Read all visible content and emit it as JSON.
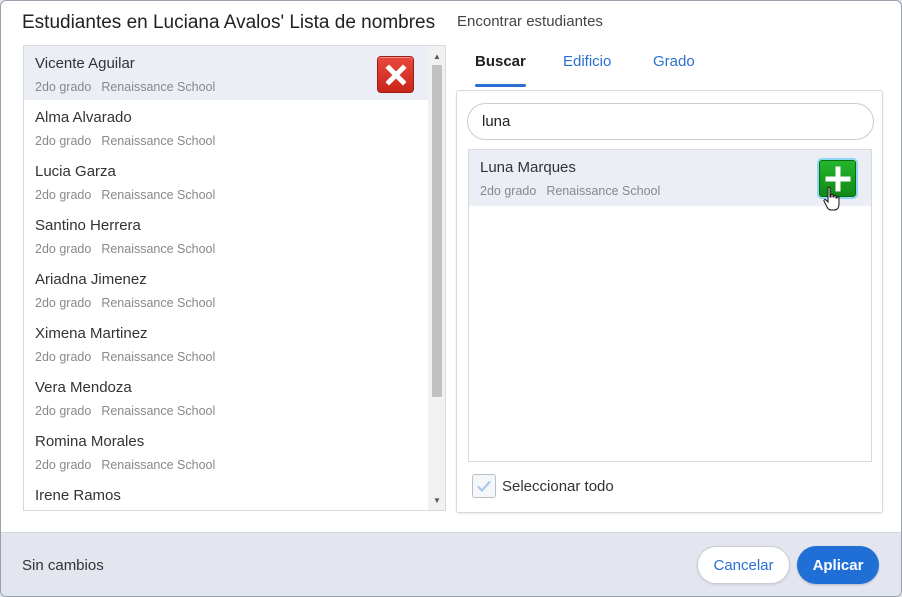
{
  "dialog": {
    "title": "Estudiantes en Luciana Avalos' Lista de nombres",
    "find_title": "Encontrar estudiantes"
  },
  "roster": {
    "students": [
      {
        "name": "Vicente Aguilar",
        "grade": "2do grado",
        "school": "Renaissance School"
      },
      {
        "name": "Alma Alvarado",
        "grade": "2do grado",
        "school": "Renaissance School"
      },
      {
        "name": "Lucia Garza",
        "grade": "2do grado",
        "school": "Renaissance School"
      },
      {
        "name": "Santino Herrera",
        "grade": "2do grado",
        "school": "Renaissance School"
      },
      {
        "name": "Ariadna Jimenez",
        "grade": "2do grado",
        "school": "Renaissance School"
      },
      {
        "name": "Ximena Martinez",
        "grade": "2do grado",
        "school": "Renaissance School"
      },
      {
        "name": "Vera Mendoza",
        "grade": "2do grado",
        "school": "Renaissance School"
      },
      {
        "name": "Romina Morales",
        "grade": "2do grado",
        "school": "Renaissance School"
      },
      {
        "name": "Irene Ramos",
        "grade": "",
        "school": ""
      }
    ]
  },
  "tabs": {
    "search": "Buscar",
    "building": "Edificio",
    "grade": "Grado"
  },
  "search": {
    "value": "luna",
    "results": [
      {
        "name": "Luna Marques",
        "grade": "2do grado",
        "school": "Renaissance School"
      }
    ],
    "select_all_label": "Seleccionar todo"
  },
  "footer": {
    "status": "Sin cambios",
    "cancel_label": "Cancelar",
    "apply_label": "Aplicar"
  },
  "colors": {
    "accent": "#1f6fd6",
    "remove": "#d9342a",
    "add": "#14a01c"
  }
}
